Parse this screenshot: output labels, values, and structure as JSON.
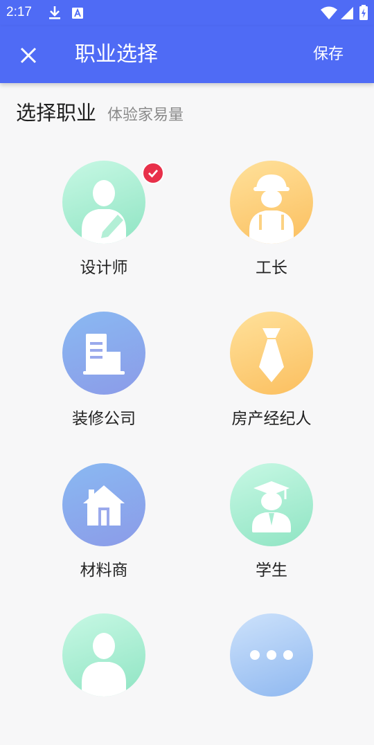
{
  "status_bar": {
    "time": "2:17",
    "icons": [
      "download-icon",
      "a-text-icon",
      "wifi-icon",
      "cellular-signal-icon",
      "battery-charging-icon"
    ]
  },
  "app_bar": {
    "close_icon": "close-icon",
    "title": "职业选择",
    "save_label": "保存"
  },
  "section": {
    "title": "选择职业",
    "subtitle": "体验家易量"
  },
  "colors": {
    "primary": "#4f6bf5",
    "selected_badge": "#e8304a",
    "background": "#f7f7f8"
  },
  "professions": [
    {
      "label": "设计师",
      "icon": "designer-icon",
      "gradient": "green",
      "selected": true
    },
    {
      "label": "工长",
      "icon": "foreman-hardhat-icon",
      "gradient": "orange",
      "selected": false
    },
    {
      "label": "装修公司",
      "icon": "building-icon",
      "gradient": "blue",
      "selected": false
    },
    {
      "label": "房产经纪人",
      "icon": "tie-icon",
      "gradient": "orange",
      "selected": false
    },
    {
      "label": "材料商",
      "icon": "house-icon",
      "gradient": "blue",
      "selected": false
    },
    {
      "label": "学生",
      "icon": "graduate-icon",
      "gradient": "green",
      "selected": false
    },
    {
      "label": "",
      "icon": "person-icon",
      "gradient": "green",
      "selected": false
    },
    {
      "label": "",
      "icon": "more-dots-icon",
      "gradient": "lightblue",
      "selected": false
    }
  ]
}
